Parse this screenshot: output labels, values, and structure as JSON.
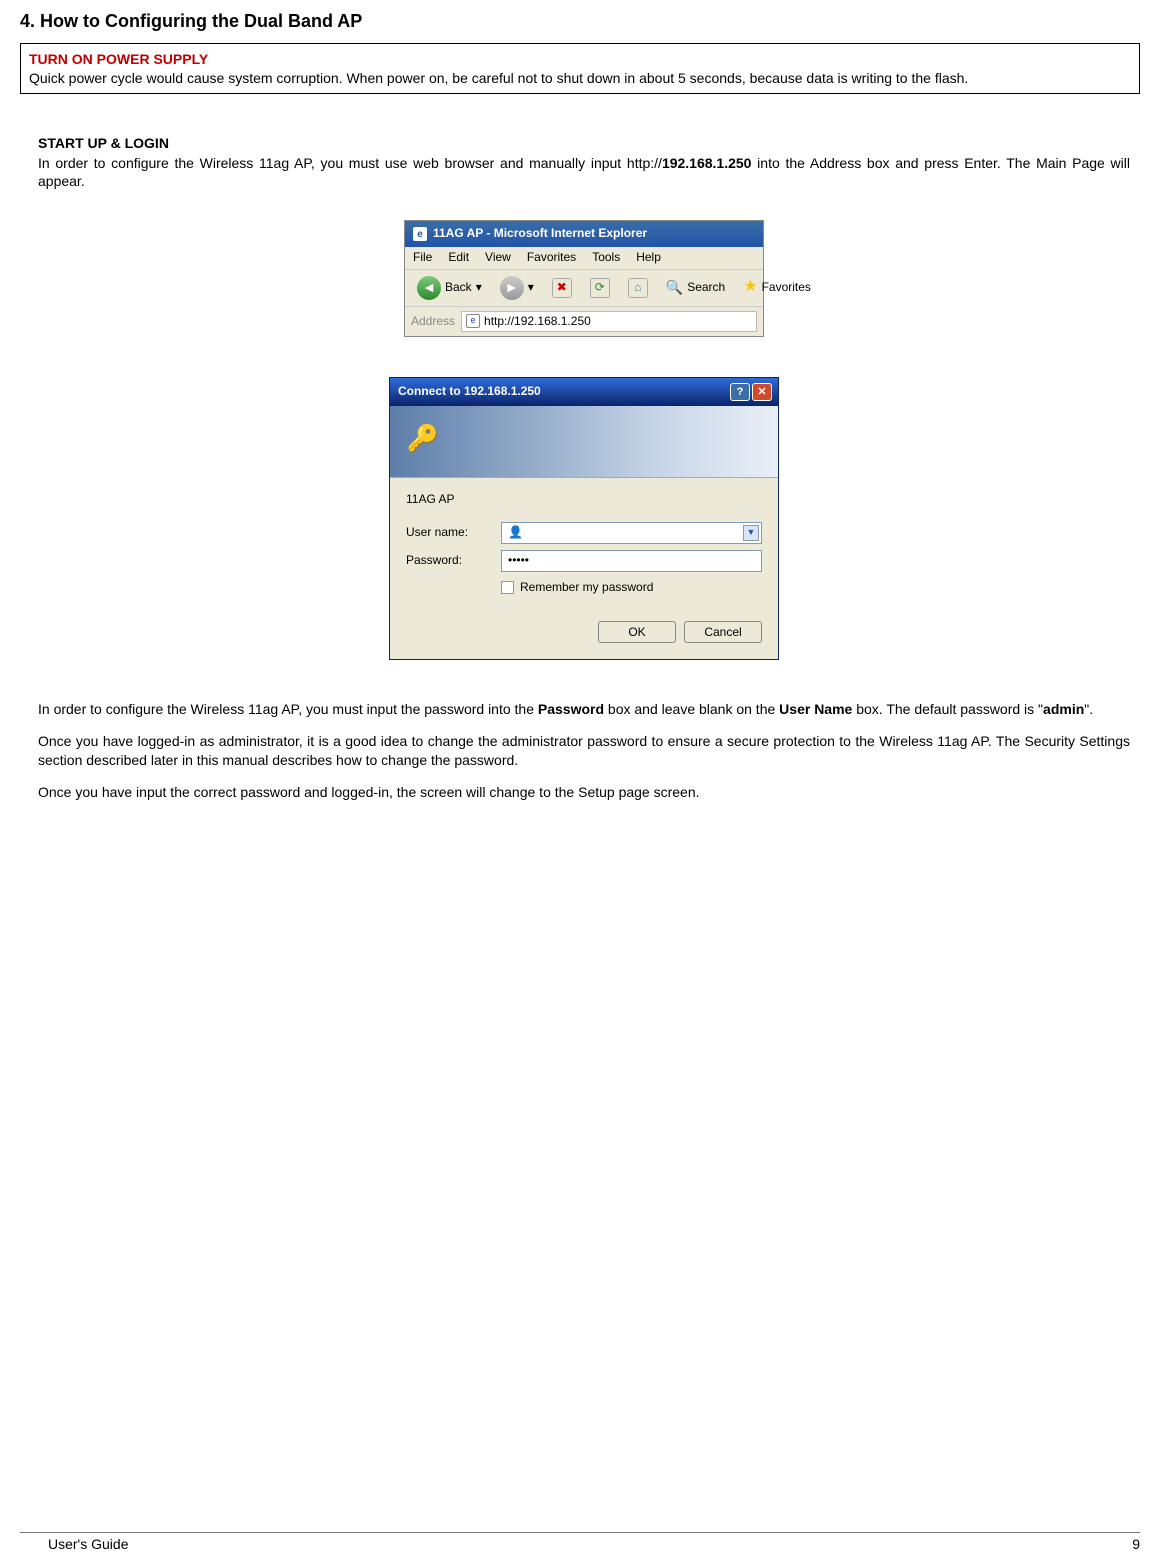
{
  "section_title": "4. How to Configuring the Dual Band AP",
  "warning": {
    "title": "TURN ON POWER SUPPLY",
    "text": "Quick power cycle would cause system corruption. When power on, be careful not to shut down in about 5 seconds, because data is writing to the flash."
  },
  "startup": {
    "title": "START UP & LOGIN",
    "intro_before_bold": "In order to configure the Wireless 11ag AP, you must use web browser and manually input http://",
    "intro_bold": "192.168.1.250",
    "intro_after_bold": " into the Address box and press Enter. The Main Page will appear."
  },
  "browser": {
    "title": "11AG AP - Microsoft Internet Explorer",
    "menu": [
      "File",
      "Edit",
      "View",
      "Favorites",
      "Tools",
      "Help"
    ],
    "back_label": "Back",
    "search_label": "Search",
    "favorites_label": "Favorites",
    "address_label": "Address",
    "address_value": "http://192.168.1.250"
  },
  "login_dialog": {
    "title": "Connect to 192.168.1.250",
    "realm": "11AG AP",
    "username_label": "User name:",
    "username_value": "",
    "password_label": "Password:",
    "password_value": "•••••",
    "remember_label": "Remember my password",
    "ok_label": "OK",
    "cancel_label": "Cancel"
  },
  "paragraphs": {
    "p1_a": "In order to configure the Wireless 11ag AP, you must input the password into the ",
    "p1_b": "Password",
    "p1_c": " box and leave blank on the ",
    "p1_d": "User Name",
    "p1_e": " box. The default password is \"",
    "p1_f": "admin",
    "p1_g": "\".",
    "p2": "Once you have logged-in as administrator, it is a good idea to change the administrator password to ensure a secure protection to the Wireless 11ag AP. The Security Settings section described later in this manual describes how to change the password.",
    "p3": "Once you have input the correct password and logged-in, the screen will change to the Setup page screen."
  },
  "footer": {
    "left": "User's Guide",
    "right": "9"
  }
}
